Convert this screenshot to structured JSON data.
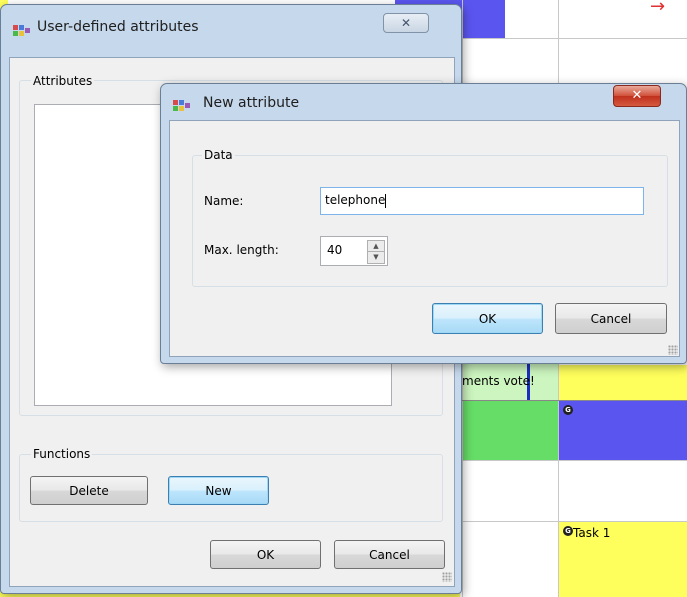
{
  "background": {
    "cells": [
      {
        "text": "ments vote!"
      },
      {
        "text": "Task 1",
        "marker": "G"
      },
      {
        "marker": "G"
      }
    ],
    "colors": {
      "blue": "#5b55f0",
      "yellow": "#fefe5c",
      "green": "#66dd66",
      "lightgreen": "#ccf5bf"
    }
  },
  "parent_dialog": {
    "title": "User-defined attributes",
    "attributes_group": "Attributes",
    "functions_group": "Functions",
    "delete_button": "Delete",
    "new_button": "New",
    "ok_button": "OK",
    "cancel_button": "Cancel"
  },
  "child_dialog": {
    "title": "New attribute",
    "data_group": "Data",
    "name_label": "Name:",
    "name_value": "telephone",
    "maxlength_label": "Max. length:",
    "maxlength_value": "40",
    "ok_button": "OK",
    "cancel_button": "Cancel"
  },
  "icons": {
    "app": "app-icon",
    "close": "close-icon",
    "spinner_up": "spin-up-icon",
    "spinner_down": "spin-down-icon"
  }
}
